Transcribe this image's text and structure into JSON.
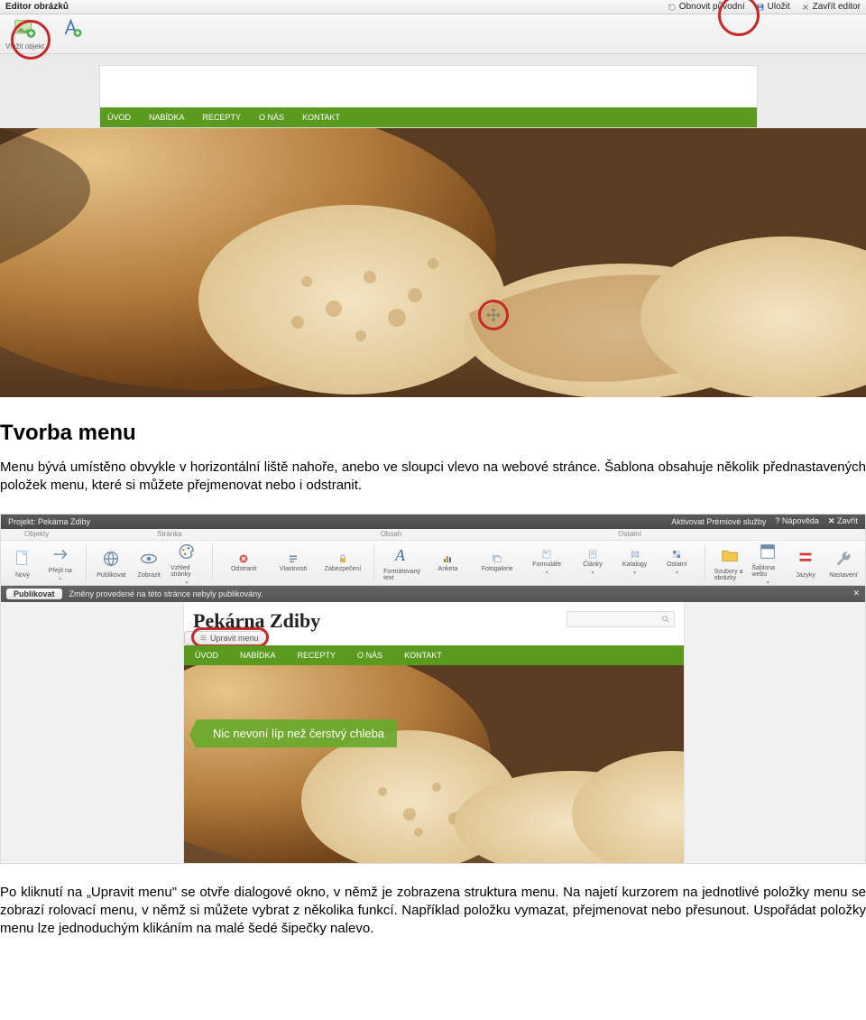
{
  "editor": {
    "title": "Editor obrázků",
    "restore": "Obnovit původní",
    "save": "Uložit",
    "close": "Zavřít editor",
    "tool_insert_object_label": "Vložit objekt"
  },
  "nav1": {
    "items": [
      "ÚVOD",
      "NABÍDKA",
      "RECEPTY",
      "O NÁS",
      "KONTAKT"
    ]
  },
  "section1": {
    "heading": "Tvorba menu",
    "paragraph": "Menu bývá umístěno obvykle v horizontální liště nahoře, anebo ve sloupci vlevo na webové stránce. Šablona obsahuje několik přednastavených položek menu, které si můžete přejmenovat nebo i odstranit."
  },
  "app2": {
    "project_label": "Projekt: Pekárna Zdiby",
    "premium": "Aktivovat Prémiové služby",
    "help": "Nápověda",
    "close": "Zavřít",
    "tab_groups": [
      "Objekty",
      "Stránka",
      "Obsah",
      "Ostatní"
    ],
    "ribbon": {
      "novy": "Nový",
      "prejit": "Přejít na",
      "publikovat": "Publikovat",
      "zobrazit": "Zobrazit",
      "vzhled": "Vzhled stránky",
      "odstranit": "Odstranit",
      "vlastnosti": "Vlastnosti",
      "zabezpeceni": "Zabezpečení",
      "formatovany": "Formátovaný text",
      "anketa": "Anketa",
      "fotogalerie": "Fotogalerie",
      "formulare": "Formuláře",
      "clanky": "Články",
      "katalogy": "Katalogy",
      "ostatni": "Ostatní",
      "soubory": "Soubory a obrázky",
      "sablona": "Šablona webu",
      "jazyky": "Jazyky",
      "nastaveni": "Nastavení"
    },
    "publish_btn": "Publikovat",
    "publish_msg": "Změny provedené na této stránce nebyly publikovány.",
    "site_title": "Pekárna Zdiby",
    "edit_menu_btn": "Upravit menu",
    "tagline": "Nic nevoní líp než čerstvý chleba"
  },
  "nav2": {
    "items": [
      "ÚVOD",
      "NABÍDKA",
      "RECEPTY",
      "O NÁS",
      "KONTAKT"
    ]
  },
  "section2": {
    "paragraph": "Po kliknutí na „Upravit menu\" se otvře dialogové okno, v němž je zobrazena struktura menu. Na najetí kurzorem na jednotlivé položky menu se zobrazí rolovací menu, v němž si můžete vybrat z několika funkcí. Například položku vymazat, přejmenovat nebo přesunout. Uspořádat položky menu lze jednoduchým klikáním na malé šedé šipečky nalevo."
  }
}
